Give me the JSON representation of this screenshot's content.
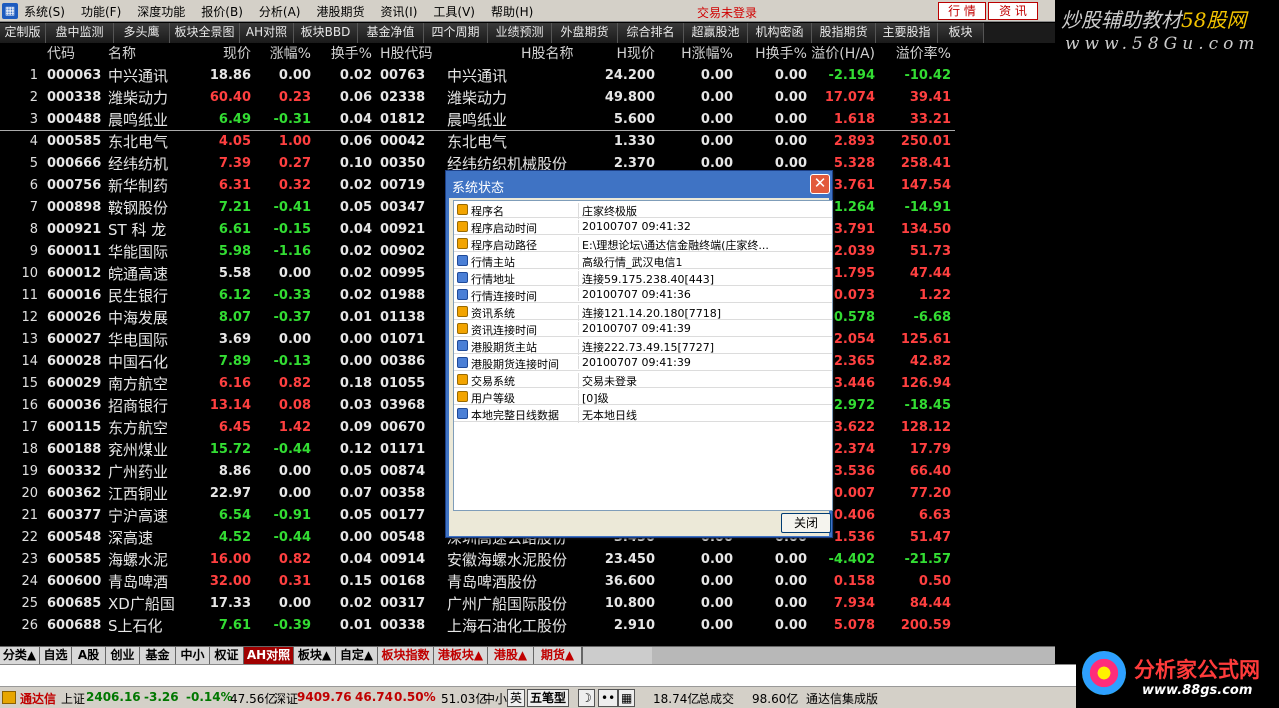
{
  "menubar": {
    "items": [
      "系统(S)",
      "功能(F)",
      "深度功能",
      "报价(B)",
      "分析(A)",
      "港股期货",
      "资讯(I)",
      "工具(V)",
      "帮助(H)"
    ],
    "trade_status": "交易未登录",
    "btn_quote": "行 情",
    "btn_info": "资 讯"
  },
  "brand_top": {
    "line1_a": "炒股辅助教材",
    "line1_b": "58股网",
    "line2": "www.58Gu.com"
  },
  "tabs": [
    "定制版面",
    "盘中监测",
    "多头鹰",
    "板块全景图",
    "AH对照",
    "板块BBD",
    "基金净值",
    "四个周期",
    "业绩预测",
    "外盘期货",
    "综合排名",
    "超赢股池",
    "机构密函",
    "股指期货",
    "主要股指",
    "板块"
  ],
  "headers": {
    "code": "代码",
    "name": "名称",
    "price": "现价",
    "chg": "涨幅%",
    "turn": "换手%",
    "hcode": "H股代码",
    "hname": "H股名称",
    "hprice": "H现价",
    "hchg": "H涨幅%",
    "hturn": "H换手%",
    "premium": "溢价(H/A)",
    "rate": "溢价率%"
  },
  "rows": [
    [
      "1",
      "000063",
      "中兴通讯",
      "18.86",
      "0.00",
      "0.02",
      "00763",
      "中兴通讯",
      "24.200",
      "0.00",
      "0.00",
      "-2.194",
      "-10.42"
    ],
    [
      "2",
      "000338",
      "潍柴动力",
      "60.40",
      "0.23",
      "0.06",
      "02338",
      "潍柴动力",
      "49.800",
      "0.00",
      "0.00",
      "17.074",
      "39.41"
    ],
    [
      "3",
      "000488",
      "晨鸣纸业",
      "6.49",
      "-0.31",
      "0.04",
      "01812",
      "晨鸣纸业",
      "5.600",
      "0.00",
      "0.00",
      "1.618",
      "33.21"
    ],
    [
      "4",
      "000585",
      "东北电气",
      "4.05",
      "1.00",
      "0.06",
      "00042",
      "东北电气",
      "1.330",
      "0.00",
      "0.00",
      "2.893",
      "250.01"
    ],
    [
      "5",
      "000666",
      "经纬纺机",
      "7.39",
      "0.27",
      "0.10",
      "00350",
      "经纬纺织机械股份",
      "2.370",
      "0.00",
      "0.00",
      "5.328",
      "258.41"
    ],
    [
      "6",
      "000756",
      "新华制药",
      "6.31",
      "0.32",
      "0.02",
      "00719",
      "",
      "",
      "",
      "",
      "3.761",
      "147.54"
    ],
    [
      "7",
      "000898",
      "鞍钢股份",
      "7.21",
      "-0.41",
      "0.05",
      "00347",
      "",
      "",
      "",
      "",
      "-1.264",
      "-14.91"
    ],
    [
      "8",
      "000921",
      "ST 科 龙",
      "6.61",
      "-0.15",
      "0.04",
      "00921",
      "",
      "",
      "",
      "",
      "3.791",
      "134.50"
    ],
    [
      "9",
      "600011",
      "华能国际",
      "5.98",
      "-1.16",
      "0.02",
      "00902",
      "",
      "",
      "",
      "",
      "2.039",
      "51.73"
    ],
    [
      "10",
      "600012",
      "皖通高速",
      "5.58",
      "0.00",
      "0.02",
      "00995",
      "",
      "",
      "",
      "",
      "1.795",
      "47.44"
    ],
    [
      "11",
      "600016",
      "民生银行",
      "6.12",
      "-0.33",
      "0.02",
      "01988",
      "",
      "",
      "",
      "",
      "0.073",
      "1.22"
    ],
    [
      "12",
      "600026",
      "中海发展",
      "8.07",
      "-0.37",
      "0.01",
      "01138",
      "",
      "",
      "",
      "",
      "-0.578",
      "-6.68"
    ],
    [
      "13",
      "600027",
      "华电国际",
      "3.69",
      "0.00",
      "0.00",
      "01071",
      "",
      "",
      "",
      "",
      "2.054",
      "125.61"
    ],
    [
      "14",
      "600028",
      "中国石化",
      "7.89",
      "-0.13",
      "0.00",
      "00386",
      "",
      "",
      "",
      "",
      "2.365",
      "42.82"
    ],
    [
      "15",
      "600029",
      "南方航空",
      "6.16",
      "0.82",
      "0.18",
      "01055",
      "",
      "",
      "",
      "",
      "3.446",
      "126.94"
    ],
    [
      "16",
      "600036",
      "招商银行",
      "13.14",
      "0.08",
      "0.03",
      "03968",
      "",
      "",
      "",
      "",
      "-2.972",
      "-18.45"
    ],
    [
      "17",
      "600115",
      "东方航空",
      "6.45",
      "1.42",
      "0.09",
      "00670",
      "",
      "",
      "",
      "",
      "3.622",
      "128.12"
    ],
    [
      "18",
      "600188",
      "兖州煤业",
      "15.72",
      "-0.44",
      "0.12",
      "01171",
      "",
      "",
      "",
      "",
      "2.374",
      "17.79"
    ],
    [
      "19",
      "600332",
      "广州药业",
      "8.86",
      "0.00",
      "0.05",
      "00874",
      "",
      "",
      "",
      "",
      "3.536",
      "66.40"
    ],
    [
      "20",
      "600362",
      "江西铜业",
      "22.97",
      "0.00",
      "0.07",
      "00358",
      "",
      "",
      "",
      "",
      "10.007",
      "77.20"
    ],
    [
      "21",
      "600377",
      "宁沪高速",
      "6.54",
      "-0.91",
      "0.05",
      "00177",
      "",
      "",
      "",
      "",
      "0.406",
      "6.63"
    ],
    [
      "22",
      "600548",
      "深高速",
      "4.52",
      "-0.44",
      "0.00",
      "00548",
      "深圳高速公路股份",
      "3.450",
      "0.00",
      "0.00",
      "1.536",
      "51.47"
    ],
    [
      "23",
      "600585",
      "海螺水泥",
      "16.00",
      "0.82",
      "0.04",
      "00914",
      "安徽海螺水泥股份",
      "23.450",
      "0.00",
      "0.00",
      "-4.402",
      "-21.57"
    ],
    [
      "24",
      "600600",
      "青岛啤酒",
      "32.00",
      "0.31",
      "0.15",
      "00168",
      "青岛啤酒股份",
      "36.600",
      "0.00",
      "0.00",
      "0.158",
      "0.50"
    ],
    [
      "25",
      "600685",
      "XD广船国",
      "17.33",
      "0.00",
      "0.02",
      "00317",
      "广州广船国际股份",
      "10.800",
      "0.00",
      "0.00",
      "7.934",
      "84.44"
    ],
    [
      "26",
      "600688",
      "S上石化",
      "7.61",
      "-0.39",
      "0.01",
      "00338",
      "上海石油化工股份",
      "2.910",
      "0.00",
      "0.00",
      "5.078",
      "200.59"
    ]
  ],
  "bottom_tabs": [
    "分类▲",
    "自选",
    "A股",
    "创业",
    "基金",
    "中小",
    "权证",
    "AH对照",
    "板块▲",
    "自定▲",
    "板块指数",
    "港板块▲",
    "港股▲",
    "期货▲"
  ],
  "status": {
    "app": "通达信",
    "sh_label": "上证",
    "sh_index": "2406.16",
    "sh_chg": "-3.26",
    "sh_pct": "-0.14%",
    "sh_amt": "47.56亿",
    "sz_label": "深证",
    "sz_index": "9409.76",
    "sz_chg": "46.74",
    "sz_pct": "0.50%",
    "sz_amt": "51.03亿",
    "mid": "中小",
    "style": "五笔型",
    "total_amt": "18.74亿",
    "total_label": "总成交",
    "amt2": "98.60亿",
    "edition": "通达信集成版"
  },
  "brand_bottom": {
    "title": "分析家公式网",
    "url": "www.88gs.com"
  },
  "dialog": {
    "title": "系统状态",
    "close_label": "关闭",
    "rows": [
      {
        "icon": "o",
        "key": "程序名",
        "value": "庄家终极版"
      },
      {
        "icon": "o",
        "key": "程序启动时间",
        "value": "20100707 09:41:32"
      },
      {
        "icon": "o",
        "key": "程序启动路径",
        "value": "E:\\理想论坛\\通达信金融终端(庄家终..."
      },
      {
        "icon": "b",
        "key": "行情主站",
        "value": "高级行情_武汉电信1"
      },
      {
        "icon": "b",
        "key": "行情地址",
        "value": "连接59.175.238.40[443]"
      },
      {
        "icon": "b",
        "key": "行情连接时间",
        "value": "20100707 09:41:36"
      },
      {
        "icon": "o",
        "key": "资讯系统",
        "value": "连接121.14.20.180[7718]"
      },
      {
        "icon": "o",
        "key": "资讯连接时间",
        "value": "20100707 09:41:39"
      },
      {
        "icon": "b",
        "key": "港股期货主站",
        "value": "连接222.73.49.15[7727]"
      },
      {
        "icon": "b",
        "key": "港股期货连接时间",
        "value": "20100707 09:41:39"
      },
      {
        "icon": "o",
        "key": "交易系统",
        "value": "交易未登录"
      },
      {
        "icon": "o",
        "key": "用户等级",
        "value": "[0]级"
      },
      {
        "icon": "b",
        "key": "本地完整日线数据",
        "value": "无本地日线"
      }
    ]
  }
}
